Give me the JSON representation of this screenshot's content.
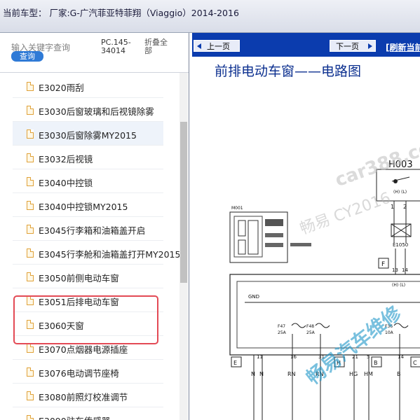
{
  "header": {
    "title": "当前车型： 厂家:G-广汽菲亚特菲翔（Viaggio）2014-2016"
  },
  "sidebar": {
    "search_label": "输入关键字查询",
    "search_button": "查询",
    "pc_code": "PC.145-34014",
    "fold_all": "折叠全部",
    "items": [
      {
        "label": "E3020雨刮"
      },
      {
        "label": "E3030后窗玻璃和后视镜除雾"
      },
      {
        "label": "E3030后窗除雾MY2015"
      },
      {
        "label": "E3032后视镜"
      },
      {
        "label": "E3040中控锁"
      },
      {
        "label": "E3040中控锁MY2015"
      },
      {
        "label": "E3045行李箱和油箱盖开启"
      },
      {
        "label": "E3045行李舱和油箱盖打开MY2015"
      },
      {
        "label": "E3050前侧电动车窗"
      },
      {
        "label": "E3051后排电动车窗"
      },
      {
        "label": "E3060天窗"
      },
      {
        "label": "E3070点烟器电源插座"
      },
      {
        "label": "E3076电动调节座椅"
      },
      {
        "label": "E3080前照灯校准调节"
      },
      {
        "label": "E3090驻车传感器"
      }
    ]
  },
  "viewer": {
    "prev_button": "上一页",
    "next_button": "下一页",
    "refresh_link": "[刷新当前",
    "diagram_title": "前排电动车窗——电路图",
    "watermarks": [
      "car388.com",
      "畅易",
      "CY2016",
      "畅易汽车维修"
    ],
    "diagram": {
      "labels": {
        "h003": "H003",
        "m001": "M001",
        "e1050": "E1050",
        "gnd": "GND",
        "f_box": "F",
        "f47": "F47",
        "f47_rating": "25A",
        "f48": "F48",
        "f48_rating": "25A",
        "f36": "F36",
        "f36_rating": "10A",
        "hl1": "(H) (L)",
        "hl2": "(H) (L)"
      },
      "pins_top": [
        "1",
        "2"
      ],
      "pins_mid": [
        "13",
        "14"
      ],
      "pins_bottom": [
        "11",
        "16",
        "31",
        "21",
        "5",
        "14"
      ],
      "letters_bottom": [
        "E",
        "H",
        "B",
        "C"
      ],
      "wire_labels": [
        "N",
        "N",
        "RN",
        "RN",
        "HG",
        "HM",
        "B"
      ]
    }
  }
}
